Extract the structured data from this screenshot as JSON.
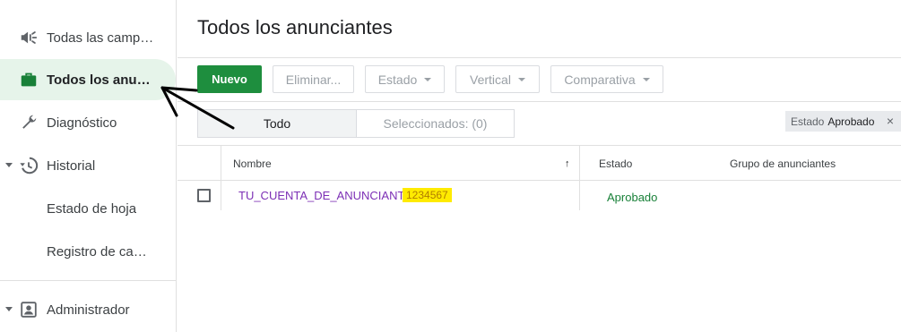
{
  "sidebar": {
    "items": [
      {
        "label": "Todas las campañas",
        "icon": "megaphone-icon"
      },
      {
        "label": "Todos los anunciantes",
        "icon": "briefcase-icon"
      },
      {
        "label": "Diagnóstico",
        "icon": "wrench-icon"
      },
      {
        "label": "Historial",
        "icon": "history-icon"
      },
      {
        "label": "Estado de hoja"
      },
      {
        "label": "Registro de cambios"
      },
      {
        "label": "Administrador",
        "icon": "account-box-icon"
      }
    ]
  },
  "page": {
    "title": "Todos los anunciantes"
  },
  "toolbar": {
    "new_label": "Nuevo",
    "delete_label": "Eliminar...",
    "status_label": "Estado",
    "vertical_label": "Vertical",
    "compare_label": "Comparativa"
  },
  "segment": {
    "all_label": "Todo",
    "selected_label": "Seleccionados: (0)"
  },
  "filter_chip": {
    "key": "Estado",
    "value": "Aprobado",
    "close": "×"
  },
  "table": {
    "headers": {
      "name": "Nombre",
      "status": "Estado",
      "group": "Grupo de anunciantes"
    },
    "sort_indicator": "↑",
    "rows": [
      {
        "name": "TU_CUENTA_DE_ANUNCIANTE",
        "id": "1234567",
        "status": "Aprobado",
        "group": ""
      }
    ]
  },
  "colors": {
    "accent": "#1e8e3e",
    "link": "#7c2fb5",
    "highlight": "#ffeb00",
    "active_nav_bg": "#e6f4ea"
  }
}
